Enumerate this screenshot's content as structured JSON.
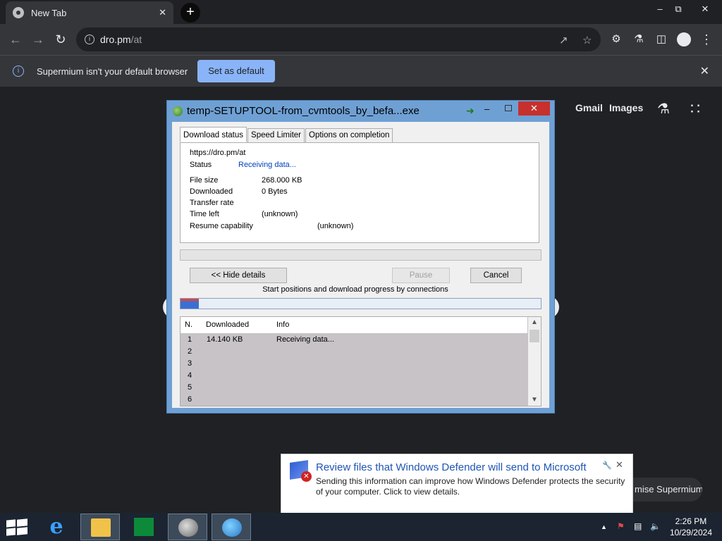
{
  "browser": {
    "tab_title": "New Tab",
    "tab_close": "✕",
    "new_tab": "+",
    "url_host": "dro.pm",
    "url_path": "/at",
    "infobar_text": "Supermium isn't your default browser",
    "infobar_button": "Set as default",
    "infobar_close": "✕"
  },
  "ntp": {
    "gmail": "Gmail",
    "images": "Images",
    "customise": "mise Supermium"
  },
  "idm": {
    "title": "temp-SETUPTOOL-from_cvmtools_by_befa...exe",
    "tabs": [
      "Download status",
      "Speed Limiter",
      "Options on completion"
    ],
    "url": "https://dro.pm/at",
    "status_label": "Status",
    "status_value": "Receiving data...",
    "file_size_label": "File size",
    "file_size_value": "268.000  KB",
    "downloaded_label": "Downloaded",
    "downloaded_value": "0 Bytes",
    "transfer_rate_label": "Transfer rate",
    "time_left_label": "Time left",
    "time_left_value": "(unknown)",
    "resume_label": "Resume capability",
    "resume_value": "(unknown)",
    "hide_details": "<< Hide details",
    "pause": "Pause",
    "cancel": "Cancel",
    "connections_label": "Start positions and download progress by connections",
    "connection_progress": 0.05,
    "columns": [
      "N.",
      "Downloaded",
      "Info"
    ],
    "rows": [
      {
        "n": "1",
        "downloaded": "14.140  KB",
        "info": "Receiving data..."
      },
      {
        "n": "2",
        "downloaded": "",
        "info": ""
      },
      {
        "n": "3",
        "downloaded": "",
        "info": ""
      },
      {
        "n": "4",
        "downloaded": "",
        "info": ""
      },
      {
        "n": "5",
        "downloaded": "",
        "info": ""
      },
      {
        "n": "6",
        "downloaded": "",
        "info": ""
      }
    ]
  },
  "toast": {
    "title": "Review files that Windows Defender will send to Microsoft",
    "body": "Sending this information can improve how Windows Defender protects the security of your computer. Click to view details."
  },
  "taskbar": {
    "time": "2:26 PM",
    "date": "10/29/2024"
  }
}
